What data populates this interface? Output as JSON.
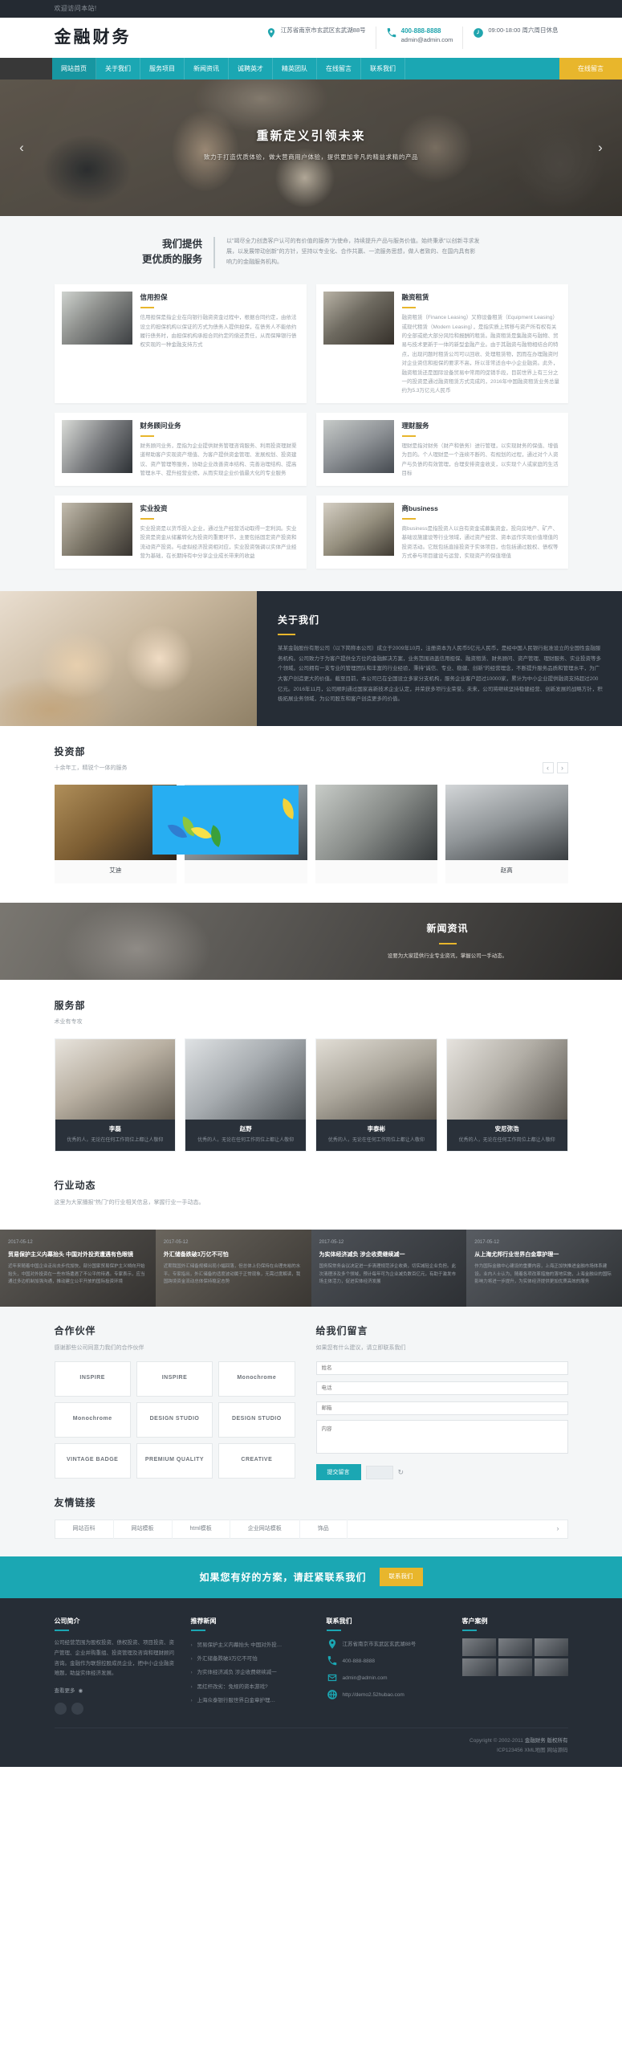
{
  "topbar": {
    "welcome": "欢迎访问本站!"
  },
  "header": {
    "logo": "金融财务",
    "contacts": [
      {
        "icon": "location-pin-icon",
        "line1": "江苏省南京市玄武区玄武湖88号",
        "line2": ""
      },
      {
        "icon": "phone-icon",
        "line1": "400-888-8888",
        "line2": "admin@admin.com"
      },
      {
        "icon": "clock-icon",
        "line1": "09:00-18:00 周六周日休息",
        "line2": ""
      }
    ]
  },
  "nav": {
    "items": [
      {
        "label": "网站首页",
        "active": true
      },
      {
        "label": "关于我们",
        "active": false
      },
      {
        "label": "服务项目",
        "active": false
      },
      {
        "label": "新闻资讯",
        "active": false
      },
      {
        "label": "诚聘英才",
        "active": false
      },
      {
        "label": "精英团队",
        "active": false
      },
      {
        "label": "在线留言",
        "active": false
      },
      {
        "label": "联系我们",
        "active": false
      }
    ],
    "cta": "在线留言"
  },
  "banner": {
    "title": "重新定义引领未来",
    "subtitle": "致力于打造优质体验，做大营商用户体验，提供更加非凡的精益求精的产品",
    "prev": "‹",
    "next": "›"
  },
  "services": {
    "heading_line1": "我们提供",
    "heading_line2": "更优质的服务",
    "intro": "以\"竭尽全力创造客户认可的有价值的服务\"为使命，持续提升产品与服务价值。始终秉承\"以创新寻求发展，以发展带动创新\"的方针，坚持以专业化、合作共赢、一流服务思想，做人者致的、在国内具有影响力的金融服务机构。",
    "cards": [
      {
        "title": "信用担保",
        "desc": "信用担保是指企业在向银行融资资金过程中，根据合同约定，由依法设立的担保机构以保证的方式为债务人提供担保，在债务人不能依约履行债务时，由担保机构承担合同约定的偿还责任，从而保障银行债权实现的一种金融支持方式"
      },
      {
        "title": "融资租赁",
        "desc": "融资租赁（Finance Leasing）又称设备租赁（Equipment Leasing）或现代租赁（Modern Leasing），是指实质上转移与资产所有权有关的全部或绝大部分风险和报酬的租赁。融资租赁是集融资与融物、贸易与技术更新于一体的新型金融产业。由于其融资与融物相结合的特点，出现问题时租赁公司可以回收、处理租赁物，因而在办理融资时对企业资信和担保的要求不高，所以非常适合中小企业融资。此外，融资租赁还是国际设备贸易中常用的促销手段，目前世界上有三分之一的投资是通过融资租赁方式完成的，2016年中国融资租赁业务总量约为5.3万亿元人民币"
      },
      {
        "title": "财务顾问业务",
        "desc": "财务顾问业务，是指为企业提供财务管理咨询服务、利用投资理财渠道帮助客户实现资产增值、为客户提供资金管理、发展规划、投资建议、资产管理等服务，协助企业改善资本结构、完善治理结构、提高管理水平、提升经营业绩，从而实现企业价值最大化的专业服务"
      },
      {
        "title": "理财服务",
        "desc": "理财是指对财务（财产和债务）进行管理，以实现财务的保值、增值为目的。个人理财是一个连续不断的、有规划的过程，通过对个人资产与负债的有效管理，合理安排资金收支，以实现个人或家庭的生活目标"
      },
      {
        "title": "实业投资",
        "desc": "实业投资是以货币投入企业，通过生产经营活动取得一定利润。实业投资是资金从储蓄转化为投资的重要环节，主要包括固定资产投资和流动资产投资。与虚拟经济投资相对应，实业投资强调以实体产业经营为基础，在长期持有中分享企业成长带来的收益"
      },
      {
        "title": "商business",
        "desc": "商business是指投资人以自有资金或募集资金，投向房地产、矿产、基础设施建设等行业领域，通过资产经营、资本运作实现价值增值的投资活动。它既包括直接投资于实体项目，也包括通过股权、债权等方式参与项目建设与运营，实现资产的保值增值"
      }
    ]
  },
  "about": {
    "title": "关于我们",
    "body": "某某金融股份有限公司（以下简称本公司）成立于2009年10月，注册资本为人民币5亿元人民币，是经中国人民银行批准设立的全国性金融服务机构。公司致力于为客户提供全方位的金融解决方案，业务范围涵盖信用担保、融资租赁、财务顾问、资产管理、理财服务、实业投资等多个领域。公司拥有一支专业的管理团队和丰富的行业经验，秉持\"诚信、专业、稳健、创新\"的经营理念，不断提升服务品质和管理水平，为广大客户创造更大的价值。截至目前，本公司已在全国设立多家分支机构，服务企业客户超过10000家，累计为中小企业提供融资支持超过200亿元。2016年11月，公司顺利通过国家高新技术企业认定，并荣获多项行业荣誉。未来，公司将继续坚持稳健经营、创新发展的战略方针，积极拓展业务领域，为公司股东和客户创造更多的价值。"
  },
  "invest": {
    "title": "投资部",
    "subtitle": "十余年工，精锐个一体的服务",
    "prev": "‹",
    "next": "›",
    "members": [
      {
        "name": "艾迪"
      },
      {
        "name": ""
      },
      {
        "name": ""
      },
      {
        "name": "赵高"
      }
    ]
  },
  "newsband": {
    "title": "新闻资讯",
    "desc": "设要为大家提供行业专业资讯，掌握公司一手动态。"
  },
  "staff": {
    "title": "服务部",
    "subtitle": "术业有专攻",
    "members": [
      {
        "name": "李磊",
        "desc": "优秀的人，无论在任何工作岗位上都让人敬仰"
      },
      {
        "name": "赵野",
        "desc": "优秀的人，无论在任何工作岗位上都让人敬仰"
      },
      {
        "name": "李泰彬",
        "desc": "优秀的人，无论在任何工作岗位上都让人敬仰"
      },
      {
        "name": "安尼弥浩",
        "desc": "优秀的人，无论在任何工作岗位上都让人敬仰"
      }
    ]
  },
  "industry": {
    "title": "行业动态",
    "subtitle": "这里为大家播报\"热门\"的行业相关信息，掌握行业一手动态。",
    "items": [
      {
        "date": "2017-05-12",
        "title": "贸易保护主义内幕抬头 中国对外投资遭遇有色眼镜",
        "desc": "近年来随着中国企业走出去步伐加快，部分国家贸易保护主义倾向开始抬头，中国对外投资在一些市场遭遇了不公平的待遇。专家表示，应当通过多边机制加强沟通，推动建立公平开放的国际投资环境"
      },
      {
        "date": "2017-05-12",
        "title": "外汇储备跌破3万亿不可怕",
        "desc": "近期我国外汇储备规模出现小幅回落，但总体上仍保持在合理充裕的水平。专家指出，外汇储备的适度波动属于正常现象，无需过度解读，我国跨境资金流动总体保持稳定态势"
      },
      {
        "date": "2017-05-12",
        "title": "为实体经济减负 涉企收费继续减一",
        "desc": "国务院常务会议决定进一步清理规范涉企收费，切实减轻企业负担。此次清理涉及多个领域，预计每年可为企业减负数百亿元，有助于激发市场主体活力，促进实体经济发展"
      },
      {
        "date": "2017-05-12",
        "title": "从上海尤邦行业世界白金章护理一",
        "desc": "作为国际金融中心建设的重要内容，上海正加快推进金融市场体系建设。业内人士认为，随着各项改革措施的落地实施，上海金融业的国际影响力将进一步提升，为实体经济提供更加优质高效的服务"
      }
    ]
  },
  "partners": {
    "title": "合作伙伴",
    "subtitle": "感谢那些公司同意力我们的合作伙伴",
    "logos": [
      "INSPIRE",
      "INSPIRE",
      "Monochrome",
      "Monochrome",
      "DESIGN STUDIO",
      "DESIGN STUDIO",
      "VINTAGE BADGE",
      "PREMIUM QUALITY",
      "CREATIVE"
    ]
  },
  "message": {
    "title": "给我们留言",
    "subtitle": "如果您有什么建议，请立即联系我们",
    "fields": [
      {
        "name": "姓名",
        "placeholder": "姓名",
        "value": ""
      },
      {
        "name": "电话",
        "placeholder": "电话",
        "value": ""
      },
      {
        "name": "邮箱",
        "placeholder": "邮箱",
        "value": ""
      }
    ],
    "textarea": {
      "placeholder": "内容",
      "value": ""
    },
    "submit": "提交留言",
    "refresh_icon": "refresh-icon"
  },
  "friendlinks": {
    "title": "友情链接",
    "items": [
      "网站百科",
      "网站模板",
      "html模板",
      "企业网站模板",
      "饰品"
    ],
    "more": "›"
  },
  "cta": {
    "text": "如果您有好的方案，请赶紧联系我们",
    "button": "联系我们"
  },
  "footer": {
    "col1": {
      "heading": "公司简介",
      "body": "公司经营范围为股权投资、债权投资、项目投资、资产管理、企业并购重组、投资管理及咨询和理财顾问咨询。金融作为联想控股成员企业，把中小企业融资难题，助益实体经济发展。",
      "more": "查看更多",
      "social": [
        "wechat-icon",
        "weibo-icon"
      ]
    },
    "col2": {
      "heading": "推荐新闻",
      "items": [
        "贸易保护主义内幕抬头 中国对外投…",
        "外汇储备跌破3万亿不可怕",
        "为实体经济减负 涉企收费继续减一",
        "黑红杆改劣：免规的资本游戏?",
        "上海众泰银行服世界白金章护理…"
      ]
    },
    "col3": {
      "heading": "联系我们",
      "items": [
        {
          "icon": "location-pin-icon",
          "text": "江苏省南京市玄武区玄武湖88号"
        },
        {
          "icon": "phone-icon",
          "text": "400-888-8888"
        },
        {
          "icon": "mail-icon",
          "text": "admin@admin.com"
        },
        {
          "icon": "globe-icon",
          "text": "http://demo2.52hubao.com"
        }
      ]
    },
    "col4": {
      "heading": "客户案例"
    },
    "copyright_line1_prefix": "Copyright © 2002-2011",
    "copyright_line1_strong": "金融财务 版权所有",
    "copyright_line2": "ICP123456 XML地图 网站源码"
  }
}
